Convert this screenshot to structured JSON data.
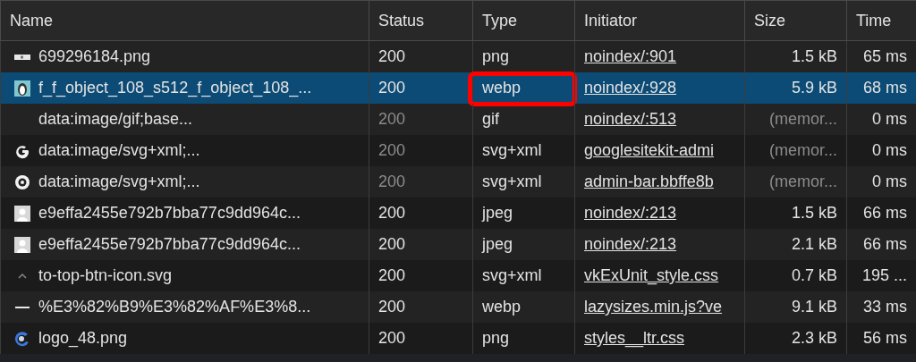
{
  "table": {
    "columns": [
      "Name",
      "Status",
      "Type",
      "Initiator",
      "Size",
      "Time"
    ],
    "rows": [
      {
        "kind": "image-strip",
        "name": "699296184.png",
        "status": "200",
        "type": "png",
        "initiator": "noindex/:901",
        "size": "1.5 kB",
        "time": "65 ms",
        "selected": false,
        "cached": false,
        "highlighted": false
      },
      {
        "kind": "penguin",
        "name": "f_f_object_108_s512_f_object_108_...",
        "status": "200",
        "type": "webp",
        "initiator": "noindex/:928",
        "size": "5.9 kB",
        "time": "68 ms",
        "selected": true,
        "cached": false,
        "highlighted": true
      },
      {
        "name": "data:image/gif;base...",
        "status": "200",
        "type": "gif",
        "initiator": "noindex/:513",
        "size": "(memor...",
        "time": "0 ms",
        "selected": false,
        "cached": true,
        "highlighted": false
      },
      {
        "kind": "g-letter",
        "name": "data:image/svg+xml;...",
        "status": "200",
        "type": "svg+xml",
        "initiator": "googlesitekit-admi",
        "size": "(memor...",
        "time": "0 ms",
        "selected": false,
        "cached": true,
        "highlighted": false
      },
      {
        "kind": "gear",
        "name": "data:image/svg+xml;...",
        "status": "200",
        "type": "svg+xml",
        "initiator": "admin-bar.bbffe8b",
        "size": "(memor...",
        "time": "0 ms",
        "selected": false,
        "cached": true,
        "highlighted": false
      },
      {
        "kind": "person",
        "name": "e9effa2455e792b7bba77c9dd964c...",
        "status": "200",
        "type": "jpeg",
        "initiator": "noindex/:213",
        "size": "1.5 kB",
        "time": "66 ms",
        "selected": false,
        "cached": false,
        "highlighted": false
      },
      {
        "kind": "person",
        "name": "e9effa2455e792b7bba77c9dd964c...",
        "status": "200",
        "type": "jpeg",
        "initiator": "noindex/:213",
        "size": "2.1 kB",
        "time": "66 ms",
        "selected": false,
        "cached": false,
        "highlighted": false
      },
      {
        "kind": "caret",
        "name": "to-top-btn-icon.svg",
        "status": "200",
        "type": "svg+xml",
        "initiator": "vkExUnit_style.css",
        "size": "0.7 kB",
        "time": "195 ...",
        "selected": false,
        "cached": false,
        "highlighted": false
      },
      {
        "kind": "dash",
        "name": "%E3%82%B9%E3%82%AF%E3%8...",
        "status": "200",
        "type": "webp",
        "initiator": "lazysizes.min.js?ve",
        "size": "9.1 kB",
        "time": "33 ms",
        "selected": false,
        "cached": false,
        "highlighted": false
      },
      {
        "kind": "swirl",
        "name": "logo_48.png",
        "status": "200",
        "type": "png",
        "initiator": "styles__ltr.css",
        "size": "2.3 kB",
        "time": "56 ms",
        "selected": false,
        "cached": false,
        "highlighted": false
      }
    ]
  }
}
